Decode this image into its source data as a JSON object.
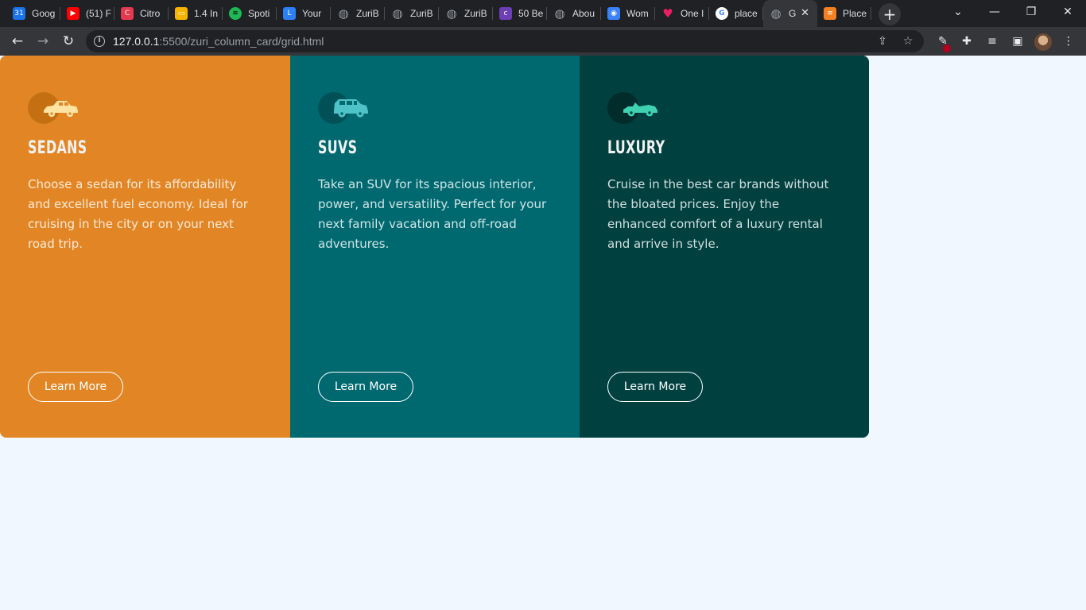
{
  "browser": {
    "tabs": [
      {
        "title": "Goog",
        "icon": "calendar-icon",
        "color": "#1a73e8"
      },
      {
        "title": "(51) F",
        "icon": "youtube-icon",
        "color": "#ff0000"
      },
      {
        "title": "Citro",
        "icon": "citro-icon",
        "color": "#e53950"
      },
      {
        "title": "1.4 In",
        "icon": "slides-icon",
        "color": "#f4b400"
      },
      {
        "title": "Spoti",
        "icon": "spotify-icon",
        "color": "#1db954"
      },
      {
        "title": "Your",
        "icon": "logo-icon",
        "color": "#2d7ff9"
      },
      {
        "title": "ZuriB",
        "icon": "globe-icon",
        "color": "#9aa0a6"
      },
      {
        "title": "ZuriB",
        "icon": "globe-icon",
        "color": "#9aa0a6"
      },
      {
        "title": "ZuriB",
        "icon": "globe-icon",
        "color": "#9aa0a6"
      },
      {
        "title": "50 Be",
        "icon": "colorlib-icon",
        "color": "#6c3fb5"
      },
      {
        "title": "Abou",
        "icon": "globe-icon",
        "color": "#9aa0a6"
      },
      {
        "title": "Wom",
        "icon": "owl-icon",
        "color": "#3b82f6"
      },
      {
        "title": "One I",
        "icon": "heart-icon",
        "color": "#e91e63"
      },
      {
        "title": "place",
        "icon": "google-icon",
        "color": "#ffffff"
      },
      {
        "title": "G",
        "icon": "globe-icon",
        "color": "#9aa0a6",
        "active": true
      },
      {
        "title": "Place",
        "icon": "stackoverflow-icon",
        "color": "#f48024"
      }
    ],
    "url_host": "127.0.0.1",
    "url_path": ":5500/zuri_column_card/grid.html"
  },
  "cards": [
    {
      "title": "SEDANS",
      "text": "Choose a sedan for its affordability and excellent fuel economy. Ideal for cruising in the city or on your next road trip.",
      "button": "Learn More",
      "bg": "#e28625",
      "accent": "#c46f12",
      "icon_color": "#ffe3a1",
      "icon": "sedan-icon"
    },
    {
      "title": "SUVS",
      "text": "Take an SUV for its spacious interior, power, and versatility. Perfect for your next family vacation and off-road adventures.",
      "button": "Learn More",
      "bg": "#006970",
      "accent": "#005057",
      "icon_color": "#4fc3c8",
      "icon": "suv-icon"
    },
    {
      "title": "LUXURY",
      "text": "Cruise in the best car brands without the bloated prices. Enjoy the enhanced comfort of a luxury rental and arrive in style.",
      "button": "Learn More",
      "bg": "#004140",
      "accent": "#002c2b",
      "icon_color": "#3ed2b0",
      "icon": "luxury-car-icon"
    }
  ]
}
